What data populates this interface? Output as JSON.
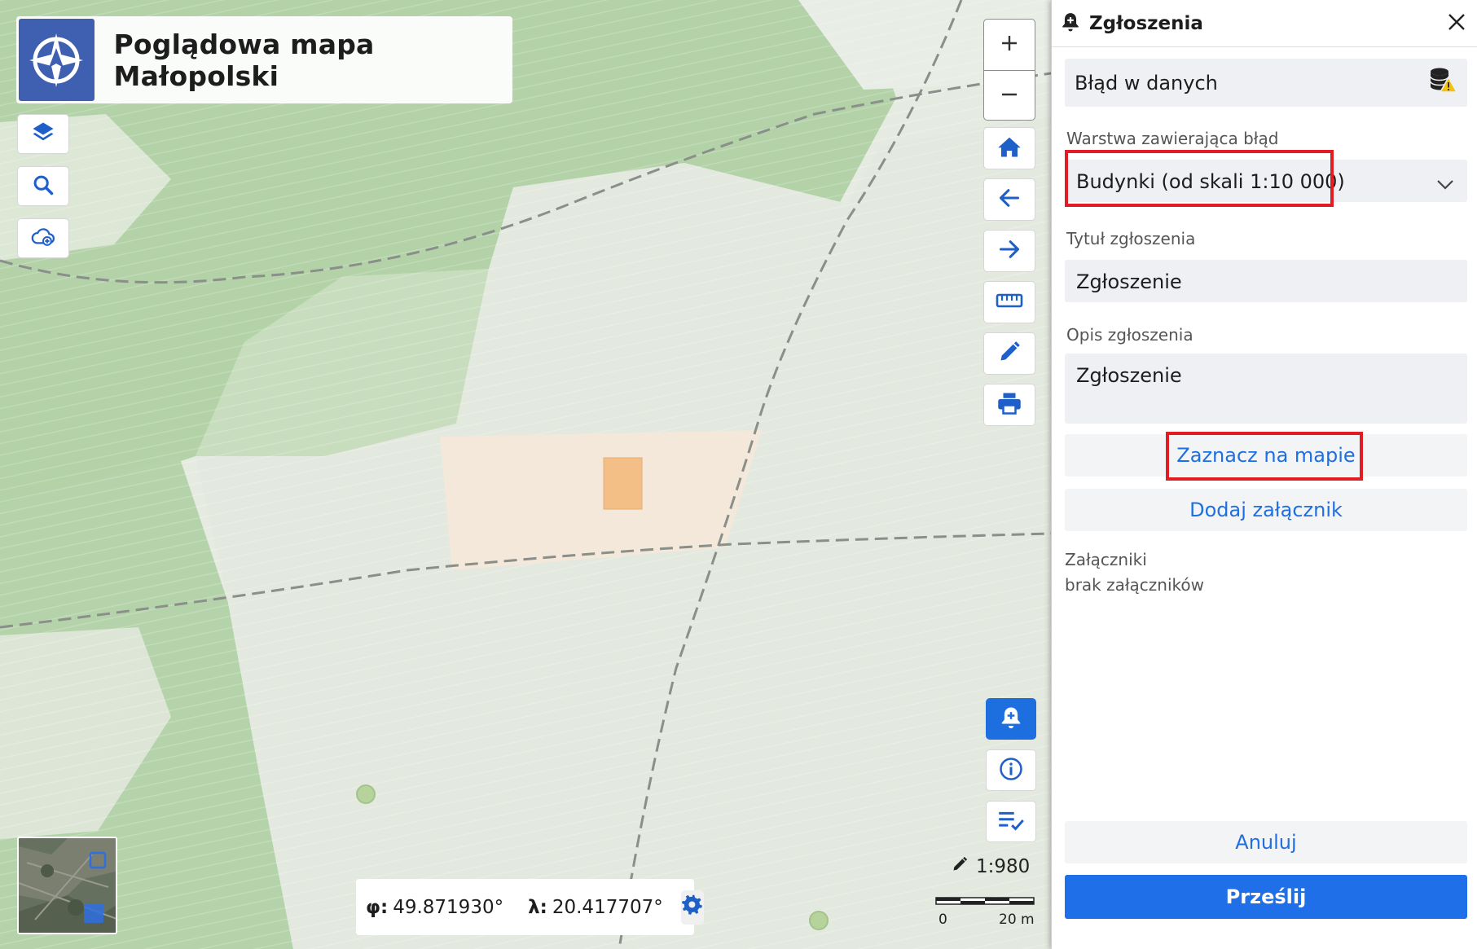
{
  "app": {
    "title": "Poglądowa mapa Małopolski"
  },
  "map": {
    "coords": {
      "lat_label": "φ:",
      "lat_value": "49.871930°",
      "lon_label": "λ:",
      "lon_value": "20.417707°"
    },
    "scale": {
      "ratio": "1:980",
      "bar_start": "0",
      "bar_end": "20 m"
    },
    "icons": {
      "left_tools": [
        "layers-icon",
        "search-icon",
        "cloud-add-icon"
      ],
      "right_tools": [
        "plus-icon",
        "minus-icon",
        "home-icon",
        "arrow-left-icon",
        "arrow-right-icon",
        "ruler-icon",
        "pencil-icon",
        "print-icon"
      ],
      "bottom_tools": [
        "bell-plus-icon",
        "info-icon",
        "list-check-icon"
      ]
    }
  },
  "panel": {
    "title": "Zgłoszenia",
    "type_value": "Błąd w danych",
    "layer_label": "Warstwa zawierająca błąd",
    "layer_value": "Budynki (od skali 1:10 000)",
    "title_label": "Tytuł zgłoszenia",
    "title_value": "Zgłoszenie",
    "desc_label": "Opis zgłoszenia",
    "desc_value": "Zgłoszenie",
    "mark_button": "Zaznacz na mapie",
    "attach_button": "Dodaj załącznik",
    "attachments_label": "Załączniki",
    "attachments_empty": "brak załączników",
    "cancel_button": "Anuluj",
    "send_button": "Prześlij"
  },
  "colors": {
    "accent": "#1f6fe0",
    "highlight": "#e01c24",
    "logo": "#3f60b0",
    "building": "#f3bf86"
  }
}
